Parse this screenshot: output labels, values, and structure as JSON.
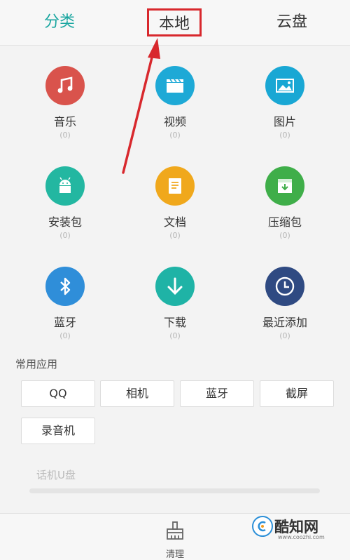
{
  "tabs": [
    {
      "label": "分类"
    },
    {
      "label": "本地"
    },
    {
      "label": "云盘"
    }
  ],
  "categories": [
    {
      "label": "音乐",
      "count": "(0)",
      "icon": "music-icon",
      "color": "#d9534c"
    },
    {
      "label": "视频",
      "count": "(0)",
      "icon": "video-icon",
      "color": "#1ea9d6"
    },
    {
      "label": "图片",
      "count": "(0)",
      "icon": "image-icon",
      "color": "#19a7d4"
    },
    {
      "label": "安装包",
      "count": "(0)",
      "icon": "android-icon",
      "color": "#23b7a1"
    },
    {
      "label": "文档",
      "count": "(0)",
      "icon": "document-icon",
      "color": "#f0a81c"
    },
    {
      "label": "压缩包",
      "count": "(0)",
      "icon": "archive-icon",
      "color": "#3fae49"
    },
    {
      "label": "蓝牙",
      "count": "(0)",
      "icon": "bluetooth-icon",
      "color": "#2f8ed9"
    },
    {
      "label": "下载",
      "count": "(0)",
      "icon": "download-icon",
      "color": "#1fb3a6"
    },
    {
      "label": "最近添加",
      "count": "(0)",
      "icon": "clock-icon",
      "color": "#2f4a82"
    }
  ],
  "common_apps": {
    "title": "常用应用",
    "items": [
      "QQ",
      "相机",
      "蓝牙",
      "截屏",
      "录音机"
    ]
  },
  "storage": {
    "label": "话机U盘"
  },
  "bottom_bar": {
    "clean_label": "清理"
  },
  "watermark": {
    "name": "酷知网",
    "url": "www.coozhi.com"
  },
  "colors": {
    "accent": "#1aa6a0",
    "highlight_box": "#d8282d",
    "arrow": "#d8282d"
  }
}
